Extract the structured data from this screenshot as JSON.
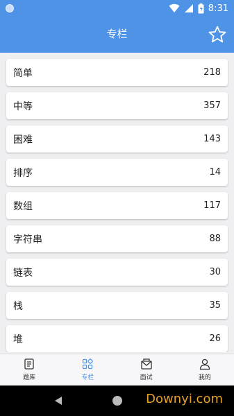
{
  "status_bar": {
    "time": "8:31"
  },
  "header": {
    "title": "专栏"
  },
  "categories": [
    {
      "label": "简单",
      "count": "218"
    },
    {
      "label": "中等",
      "count": "357"
    },
    {
      "label": "困难",
      "count": "143"
    },
    {
      "label": "排序",
      "count": "14"
    },
    {
      "label": "数组",
      "count": "117"
    },
    {
      "label": "字符串",
      "count": "88"
    },
    {
      "label": "链表",
      "count": "30"
    },
    {
      "label": "栈",
      "count": "35"
    },
    {
      "label": "堆",
      "count": "26"
    }
  ],
  "bottom_nav": [
    {
      "label": "题库",
      "icon": "question-bank-icon",
      "active": false
    },
    {
      "label": "专栏",
      "icon": "columns-grid-icon",
      "active": true
    },
    {
      "label": "面试",
      "icon": "interview-mail-icon",
      "active": false
    },
    {
      "label": "我的",
      "icon": "profile-icon",
      "active": false
    }
  ],
  "watermark": "Downyi.com",
  "colors": {
    "primary": "#4f93e6",
    "background": "#efeff2"
  }
}
